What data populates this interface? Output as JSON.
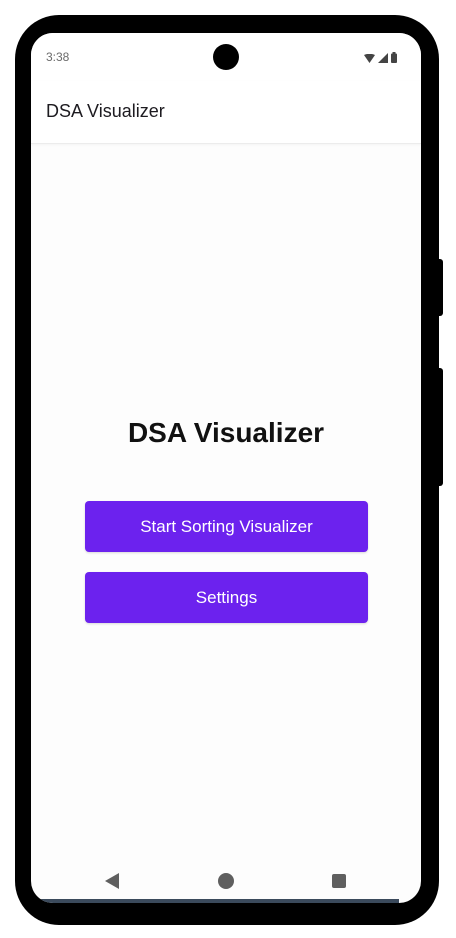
{
  "status_bar": {
    "time": "3:38",
    "icons": [
      "wifi-icon",
      "signal-icon",
      "battery-icon"
    ]
  },
  "app_bar": {
    "title": "DSA Visualizer"
  },
  "main": {
    "heading": "DSA Visualizer",
    "buttons": [
      {
        "label": "Start Sorting Visualizer"
      },
      {
        "label": "Settings"
      }
    ]
  },
  "nav_bar": {
    "icons": [
      "back-icon",
      "home-icon",
      "recents-icon"
    ]
  },
  "colors": {
    "primary": "#6c22ee",
    "on_primary": "#ffffff",
    "frame": "#000000"
  }
}
